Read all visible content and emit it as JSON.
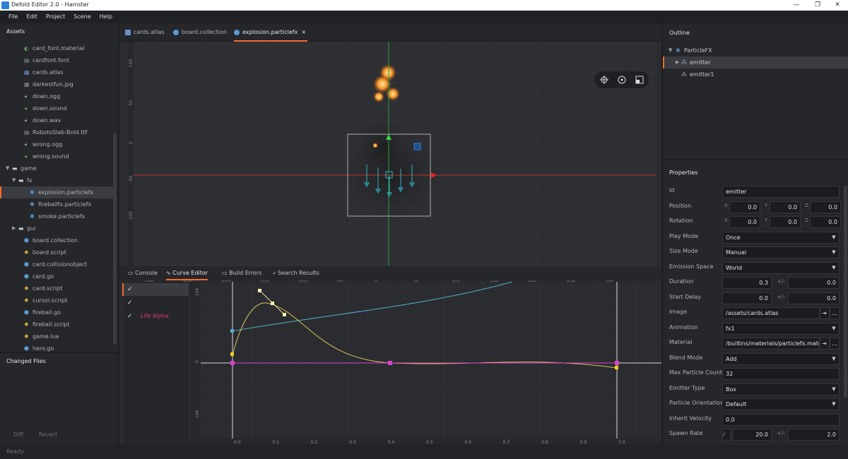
{
  "window": {
    "title": "Defold Editor 2.0 - Hamster",
    "minimize": "—",
    "maximize": "❐",
    "close": "✕"
  },
  "menu": [
    "File",
    "Edit",
    "Project",
    "Scene",
    "Help"
  ],
  "assets": {
    "header": "Assets",
    "items": [
      {
        "label": "card_font.material",
        "icon": "material-icon",
        "color": "#5fa35a",
        "depth": 2
      },
      {
        "label": "cardfont.font",
        "icon": "font-icon",
        "color": "#8a8e95",
        "depth": 2
      },
      {
        "label": "cards.atlas",
        "icon": "atlas-icon",
        "color": "#6c8fc7",
        "depth": 2
      },
      {
        "label": "darkestfun.jpg",
        "icon": "image-icon",
        "color": "#8a8e95",
        "depth": 2
      },
      {
        "label": "down.ogg",
        "icon": "sound-icon",
        "color": "#8a8e95",
        "depth": 2
      },
      {
        "label": "down.sound",
        "icon": "sound-icon",
        "color": "#5fa35a",
        "depth": 2
      },
      {
        "label": "down.wav",
        "icon": "sound-icon",
        "color": "#8a8e95",
        "depth": 2
      },
      {
        "label": "RobotoSlab-Bold.ttf",
        "icon": "font-icon",
        "color": "#8a8e95",
        "depth": 2
      },
      {
        "label": "wrong.ogg",
        "icon": "sound-icon",
        "color": "#8a8e95",
        "depth": 2
      },
      {
        "label": "wrong.sound",
        "icon": "sound-icon",
        "color": "#5fa35a",
        "depth": 2
      },
      {
        "label": "game",
        "icon": "folder-icon",
        "color": "#c9ccd1",
        "depth": 1,
        "expanded": true
      },
      {
        "label": "fx",
        "icon": "folder-icon",
        "color": "#c9ccd1",
        "depth": 2,
        "expanded": true
      },
      {
        "label": "explosion.particlefx",
        "icon": "particlefx-icon",
        "color": "#5b9bd5",
        "depth": 3,
        "selected": true
      },
      {
        "label": "fireballfx.particlefx",
        "icon": "particlefx-icon",
        "color": "#5b9bd5",
        "depth": 3
      },
      {
        "label": "smoke.particlefx",
        "icon": "particlefx-icon",
        "color": "#5b9bd5",
        "depth": 3
      },
      {
        "label": "gui",
        "icon": "folder-icon",
        "color": "#c9ccd1",
        "depth": 2,
        "expanded": false
      },
      {
        "label": "board.collection",
        "icon": "collection-icon",
        "color": "#5b9bd5",
        "depth": 2
      },
      {
        "label": "board.script",
        "icon": "script-icon",
        "color": "#d6b13b",
        "depth": 2
      },
      {
        "label": "card.collisionobject",
        "icon": "collision-icon",
        "color": "#5b9bd5",
        "depth": 2
      },
      {
        "label": "card.go",
        "icon": "gameobject-icon",
        "color": "#5b9bd5",
        "depth": 2
      },
      {
        "label": "card.script",
        "icon": "script-icon",
        "color": "#d6b13b",
        "depth": 2
      },
      {
        "label": "cursor.script",
        "icon": "script-icon",
        "color": "#d6b13b",
        "depth": 2
      },
      {
        "label": "fireball.go",
        "icon": "gameobject-icon",
        "color": "#5b9bd5",
        "depth": 2
      },
      {
        "label": "fireball.script",
        "icon": "script-icon",
        "color": "#d6b13b",
        "depth": 2
      },
      {
        "label": "game.lua",
        "icon": "script-icon",
        "color": "#d6b13b",
        "depth": 2
      },
      {
        "label": "hero.go",
        "icon": "gameobject-icon",
        "color": "#5b9bd5",
        "depth": 2
      }
    ]
  },
  "changed_files": {
    "header": "Changed Files",
    "diff": "Diff",
    "revert": "Revert"
  },
  "status": "Ready",
  "editor_tabs": [
    {
      "label": "cards.atlas",
      "icon": "atlas-icon",
      "color": "#6c8fc7"
    },
    {
      "label": "board.collection",
      "icon": "collection-icon",
      "color": "#5b9bd5"
    },
    {
      "label": "explosion.particlefx",
      "icon": "particlefx-icon",
      "color": "#5b9bd5",
      "active": true,
      "close": "×"
    }
  ],
  "viewport": {
    "x_ticks": [
      "-300",
      "-250",
      "-200",
      "-150",
      "-100",
      "-50",
      "0",
      "50",
      "100",
      "150",
      "200",
      "250",
      "300"
    ],
    "y_ticks": [
      "100",
      "50",
      "0",
      "-50",
      "-100"
    ]
  },
  "bottom_tabs": [
    {
      "label": "Console",
      "icon": "console-icon"
    },
    {
      "label": "Curve Editor",
      "icon": "curve-icon",
      "active": true
    },
    {
      "label": "Build Errors",
      "icon": "build-errors-icon"
    },
    {
      "label": "Search Results",
      "icon": "search-icon"
    }
  ],
  "curve_list": [
    {
      "label": "",
      "checked": true,
      "selected": true
    },
    {
      "label": "",
      "checked": true
    },
    {
      "label": "Life Alpha",
      "checked": true,
      "color": "#e0357a"
    }
  ],
  "curve_axis": {
    "x_ticks": [
      "0.0",
      "0.1",
      "0.2",
      "0.3",
      "0.4",
      "0.5",
      "0.6",
      "0.7",
      "0.8",
      "0.9",
      "1.0"
    ],
    "y_ticks": [
      "100",
      "0",
      "-100"
    ]
  },
  "outline": {
    "header": "Outline",
    "items": [
      {
        "label": "ParticleFX",
        "icon": "particlefx-icon",
        "depth": 0
      },
      {
        "label": "emitter",
        "icon": "emitter-icon",
        "depth": 1,
        "selected": true
      },
      {
        "label": "emitter1",
        "icon": "emitter-icon",
        "depth": 1
      }
    ]
  },
  "properties": {
    "header": "Properties",
    "id": {
      "label": "Id",
      "value": "emitter"
    },
    "position": {
      "label": "Position",
      "x": "0.0",
      "y": "0.0",
      "z": "0.0"
    },
    "rotation": {
      "label": "Rotation",
      "x": "0.0",
      "y": "0.0",
      "z": "0.0"
    },
    "play_mode": {
      "label": "Play Mode",
      "value": "Once"
    },
    "size_mode": {
      "label": "Size Mode",
      "value": "Manual"
    },
    "emission_space": {
      "label": "Emission Space",
      "value": "World"
    },
    "duration": {
      "label": "Duration",
      "value": "0.3",
      "spread": "0.0"
    },
    "start_delay": {
      "label": "Start Delay",
      "value": "0.0",
      "spread": "0.0"
    },
    "image": {
      "label": "Image",
      "value": "/assets/cards.atlas"
    },
    "animation": {
      "label": "Animation",
      "value": "fx1"
    },
    "material": {
      "label": "Material",
      "value": "/builtins/materials/particlefx.materia"
    },
    "blend_mode": {
      "label": "Blend Mode",
      "value": "Add"
    },
    "max_particle_count": {
      "label": "Max Particle Count",
      "value": "32"
    },
    "emitter_type": {
      "label": "Emitter Type",
      "value": "Box"
    },
    "particle_orientation": {
      "label": "Particle Orientation",
      "value": "Default"
    },
    "inherit_velocity": {
      "label": "Inherit Velocity",
      "value": "0.0"
    },
    "spawn_rate": {
      "label": "Spawn Rate",
      "value": "20.0",
      "spread": "2.0"
    },
    "axis_x": "X",
    "axis_y": "Y",
    "axis_z": "Z",
    "plusminus": "+/-",
    "browse": "…",
    "goto": "⇥",
    "dropdown": "▼"
  }
}
